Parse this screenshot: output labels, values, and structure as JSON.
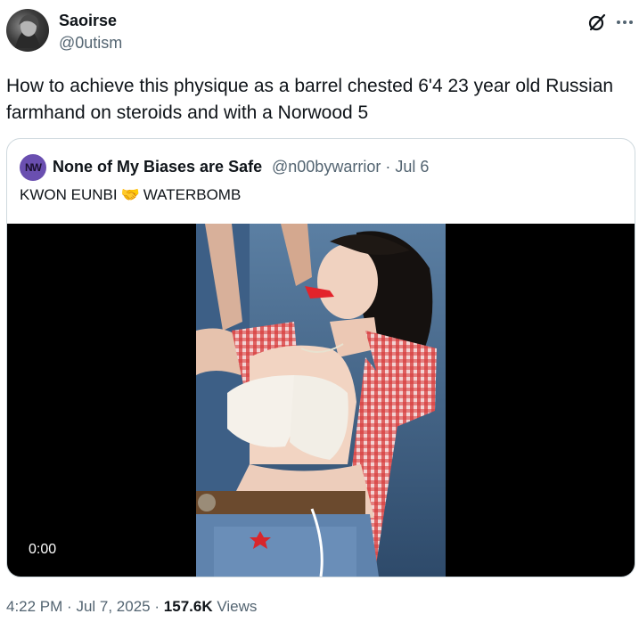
{
  "author": {
    "name": "Saoirse",
    "handle": "@0utism"
  },
  "icons": {
    "grok": "grok-icon",
    "more": "more-icon"
  },
  "tweet": {
    "text": "How to achieve this physique as a barrel chested 6'4 23 year old Russian farmhand on steroids and with a Norwood 5"
  },
  "quoted": {
    "avatar_text": "NW",
    "name": "None of My Biases are Safe",
    "handle": "@n00bywarrior",
    "separator": "·",
    "date": "Jul 6",
    "text_before": "KWON EUNBI",
    "emoji": "🤝",
    "text_after": "WATERBOMB",
    "video": {
      "duration": "0:00"
    }
  },
  "footer": {
    "time": "4:22 PM",
    "separator": "·",
    "date": "Jul 7, 2025",
    "views_count": "157.6K",
    "views_label": "Views"
  },
  "colors": {
    "text": "#0f1419",
    "secondary": "#536471",
    "border": "#cfd9de",
    "video_bg": "#000000"
  }
}
